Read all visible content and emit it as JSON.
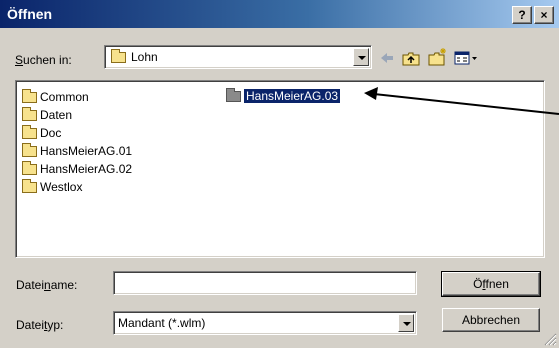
{
  "window": {
    "title": "Öffnen",
    "help_label": "?",
    "close_label": "×"
  },
  "lookin": {
    "label_pre": "",
    "label_u": "S",
    "label_post": "uchen in:",
    "value": "Lohn"
  },
  "files": [
    {
      "name": "Common"
    },
    {
      "name": "Daten"
    },
    {
      "name": "Doc"
    },
    {
      "name": "HansMeierAG.01"
    },
    {
      "name": "HansMeierAG.02"
    },
    {
      "name": "Westlox"
    }
  ],
  "selected_file": {
    "name": "HansMeierAG.03"
  },
  "filename": {
    "label_pre": "Datei",
    "label_u": "n",
    "label_post": "ame:",
    "value": ""
  },
  "filetype": {
    "label_pre": "Datei",
    "label_u": "t",
    "label_post": "yp:",
    "value": "Mandant (*.wlm)"
  },
  "buttons": {
    "open_pre": "Ö",
    "open_u": "f",
    "open_post": "fnen",
    "cancel": "Abbrechen"
  },
  "colors": {
    "selection": "#0a246a",
    "title_start": "#0a246a",
    "title_end": "#a6caf0"
  }
}
